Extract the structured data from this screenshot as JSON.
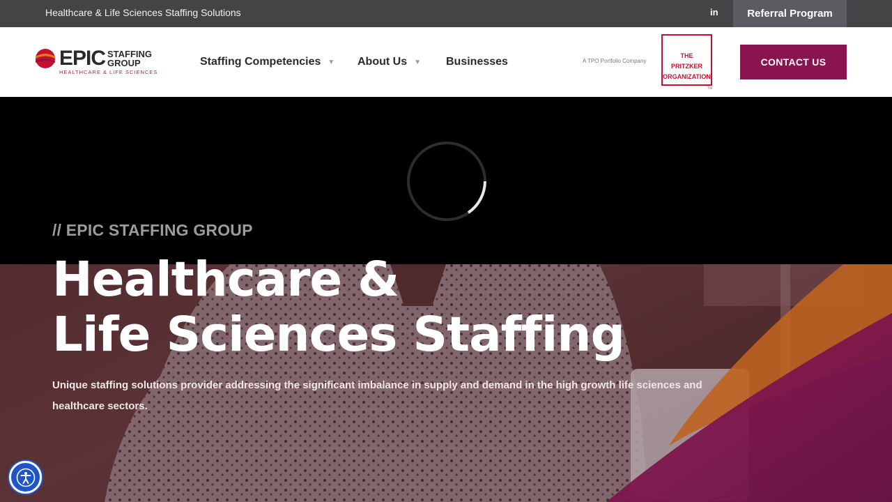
{
  "topbar": {
    "tagline": "Healthcare & Life Sciences Staffing Solutions",
    "linkedin_label": "in",
    "referral_label": "Referral Program"
  },
  "header": {
    "logo": {
      "epic": "EPIC",
      "staffing_line1": "STAFFING",
      "staffing_line2": "GROUP",
      "subtitle": "HEALTHCARE & LIFE SCIENCES"
    },
    "nav": [
      {
        "label": "Staffing Competencies",
        "has_dropdown": true
      },
      {
        "label": "About Us",
        "has_dropdown": true
      },
      {
        "label": "Businesses",
        "has_dropdown": false
      }
    ],
    "tpo_text": "A TPO Portfolio Company",
    "tpo_logo": {
      "line1": "THE",
      "line2": "PRITZKER",
      "line3": "ORGANIZATION",
      "tm": "TM"
    },
    "contact_label": "CONTACT US"
  },
  "hero": {
    "eyebrow": "// EPIC STAFFING GROUP",
    "headline_line1": "Healthcare &",
    "headline_line2": "Life Sciences Staffing",
    "description": "Unique staffing solutions provider addressing the significant imbalance in supply and demand in the high growth life sciences and healthcare sectors."
  },
  "colors": {
    "topbar": "#444446",
    "brand_magenta": "#8a1450",
    "brand_red": "#c8102e",
    "accent_orange": "#e07a1f",
    "accessibility_blue": "#1f55c7"
  },
  "icons": [
    "linkedin-icon",
    "logo-mark-icon",
    "chevron-down-icon",
    "loading-spinner-icon",
    "accessibility-icon"
  ]
}
